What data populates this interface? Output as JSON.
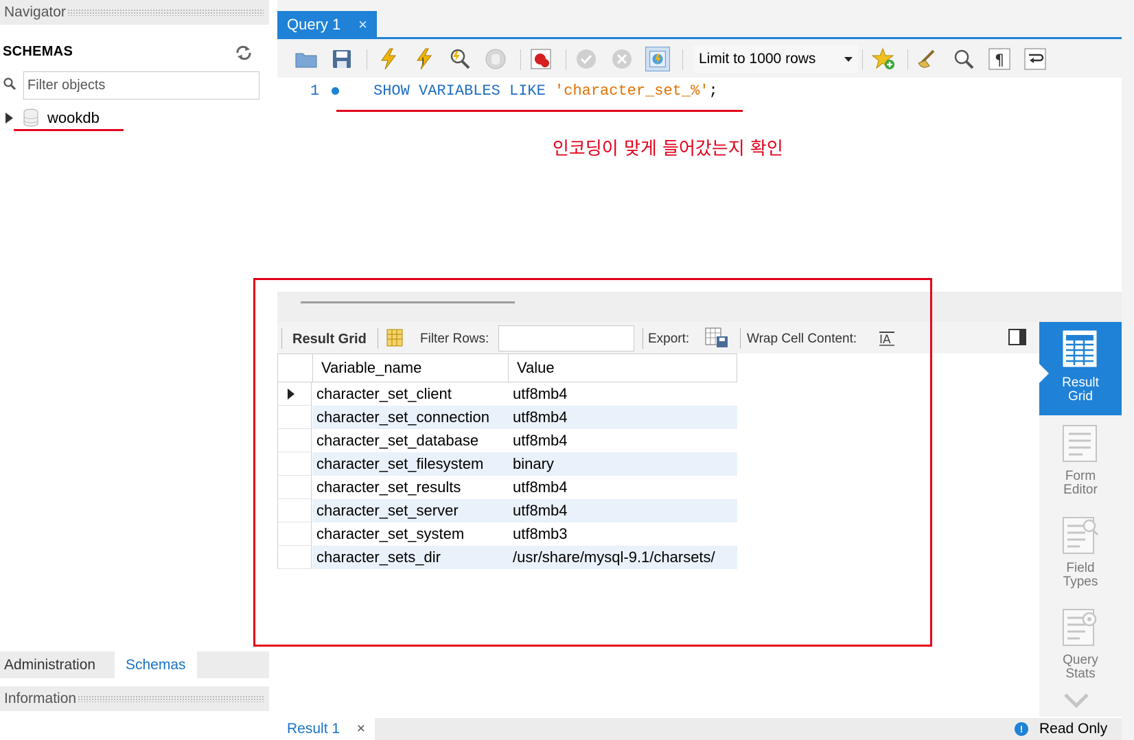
{
  "navigator": {
    "header": "Navigator",
    "schemas_title": "SCHEMAS",
    "filter_placeholder": "Filter objects",
    "tree": [
      {
        "name": "wookdb"
      }
    ],
    "tabs": [
      {
        "label": "Administration"
      },
      {
        "label": "Schemas"
      }
    ],
    "info_header": "Information"
  },
  "editor": {
    "tab_label": "Query 1",
    "tab_close": "×",
    "limit_label": "Limit to 1000 rows",
    "line_number": "1",
    "code": {
      "kw": "SHOW VARIABLES LIKE",
      "str": "'character_set_%'",
      "end": ";"
    },
    "annotation": "인코딩이 맞게 들어갔는지 확인"
  },
  "result_toolbar": {
    "result_grid": "Result Grid",
    "filter_rows": "Filter Rows:",
    "export": "Export:",
    "wrap": "Wrap Cell Content:"
  },
  "grid": {
    "columns": [
      "Variable_name",
      "Value"
    ],
    "rows": [
      [
        "character_set_client",
        "utf8mb4"
      ],
      [
        "character_set_connection",
        "utf8mb4"
      ],
      [
        "character_set_database",
        "utf8mb4"
      ],
      [
        "character_set_filesystem",
        "binary"
      ],
      [
        "character_set_results",
        "utf8mb4"
      ],
      [
        "character_set_server",
        "utf8mb4"
      ],
      [
        "character_set_system",
        "utf8mb3"
      ],
      [
        "character_sets_dir",
        "/usr/share/mysql-9.1/charsets/"
      ]
    ]
  },
  "side_panel": [
    {
      "label": "Result\nGrid",
      "icon": "result-grid-icon",
      "active": true
    },
    {
      "label": "Form\nEditor",
      "icon": "form-editor-icon",
      "active": false
    },
    {
      "label": "Field\nTypes",
      "icon": "field-types-icon",
      "active": false
    },
    {
      "label": "Query\nStats",
      "icon": "query-stats-icon",
      "active": false
    }
  ],
  "bottom": {
    "result_tab": "Result 1",
    "status": "Read Only"
  },
  "colors": {
    "accent": "#1f82d6",
    "annotation": "#e3001b",
    "keyword": "#1f6dc4",
    "string": "#e07000",
    "row_alt": "#e9f1fb"
  }
}
